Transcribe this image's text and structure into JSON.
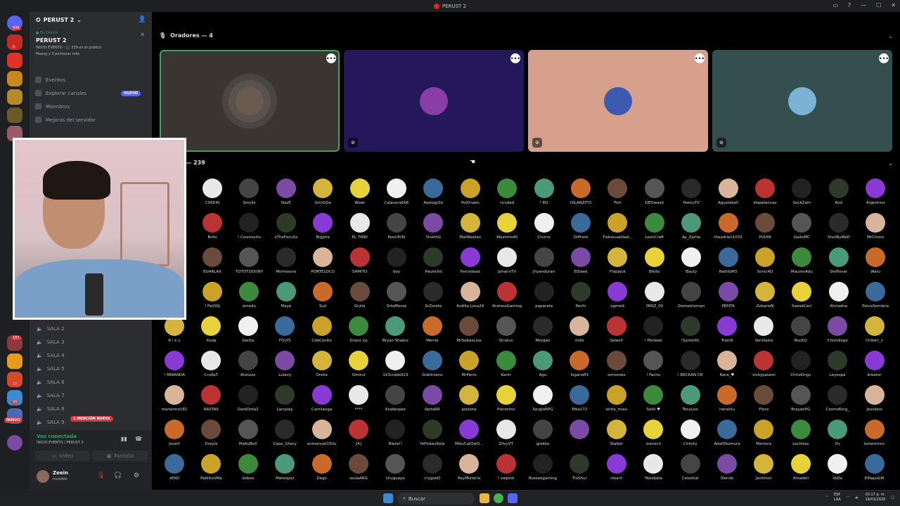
{
  "window": {
    "title": "PERUST 2",
    "controls": [
      "▭",
      "?",
      "—",
      "☐",
      "✕"
    ]
  },
  "server": {
    "name": "PERUST 2"
  },
  "event": {
    "live_label": "● En Directo",
    "name": "PERUST 2",
    "info": "INICIO EVENTO · 🎧 239 en el público",
    "attendees": "Maacg y 3 personas más"
  },
  "nav": [
    {
      "label": "Eventos",
      "badge": ""
    },
    {
      "label": "Explorar canales",
      "badge": "NUEVO"
    },
    {
      "label": "Miembros",
      "badge": ""
    },
    {
      "label": "Mejoras del servidor",
      "badge": ""
    }
  ],
  "channels": [
    "SALA 2",
    "SALA 3",
    "SALA 4",
    "SALA 5",
    "SALA 6",
    "SALA 7",
    "SALA 8",
    "SALA 9"
  ],
  "mention_badge": "1 MENCIÓN NUEVA",
  "guild_nuevo": "NUEVO",
  "guild_badges": [
    "698",
    "1",
    "187",
    "10",
    "33"
  ],
  "voice": {
    "status": "Voz conectada",
    "subtitle": "INICIO EVENTO / PERUST 2",
    "video_label": "Vídeo",
    "screen_label": "Pantalla"
  },
  "user": {
    "name": "Zeein",
    "status": "Invisible"
  },
  "speakers": {
    "header": "Oradores — 4",
    "tiles": [
      {
        "bg": "#3a3531",
        "avatar": "#6b5a50",
        "speaking": true
      },
      {
        "bg": "#24185a",
        "avatar": "#8a3ca8",
        "speaking": false
      },
      {
        "bg": "#d6a08c",
        "avatar": "#3c5bb0",
        "speaking": false
      },
      {
        "bg": "#33504f",
        "avatar": "#7ab3d4",
        "speaking": false
      }
    ]
  },
  "audience": {
    "header": "o — 239",
    "rows": [
      [
        "C0KEIN",
        "Smylls",
        "NazE",
        "GrinGGe",
        "Wowi",
        "Calavera666",
        "ApologiZe",
        "PoiOnako",
        "ricsded",
        "! M2",
        "DILANZITO",
        "Fish",
        "DEOwasd",
        "HerouTV",
        "Agustabell",
        "elapalancao",
        "SockZam",
        "Kod",
        "Argentino"
      ],
      [
        "Brito",
        "! Cosmecito",
        "xTheFocuSx",
        "BigJota",
        "EL TIRRI",
        "PoohToTo",
        "YinethG",
        "MattKeelan",
        "Mazinho40",
        "Churro",
        "Diffrent",
        "Tiokasualidad...",
        "LeonCraft",
        "Ay_Zarite",
        "theadrian1033",
        "PUDIN",
        "GaitoMC",
        "ShotByWolf",
        "MrChoco"
      ],
      [
        "EUARLAX",
        "TOTOTOOONY",
        "Momosora",
        "PORTELOCO",
        "SAMITO",
        "boy",
        "PaulieXd",
        "Fenixdead",
        "JohannTV",
        "Jhyanduran",
        "ElDaek",
        "Flapjack",
        "Bikito",
        "Bauty",
        "NathGM3",
        "Sonic4D",
        "MaurexAdu",
        "Steffovar",
        "Waru"
      ],
      [
        "! FeliSSJ",
        "omedu",
        "Maye",
        "Suit",
        "Giulio",
        "SrtaMoore",
        "SrZorete",
        "Ardilla Loca24",
        "KratossGaming",
        "paparata",
        "Pechi",
        "ogmeik",
        "!MDZ_00",
        "Demetrioman",
        "PEPITA",
        "ZekarioN",
        "SweetCeci",
        "Ahriadna",
        "ParcaSombria"
      ],
      [
        "R i k u",
        "Xoda",
        "Geitta",
        "FOLYS",
        "CdeConito",
        "Draco ssj",
        "Bryan Shakur",
        "Merrie",
        "MrSebasLive",
        "Stratus",
        "Morgan",
        "mills",
        "SeleeY",
        "! Porteee",
        "!Symerth",
        "Train9",
        "Vanillalce",
        "RocKG",
        "Chistologo",
        "Chiken_v"
      ],
      [
        "! MIRANDA",
        "CruKeT",
        "Alonzzo",
        "Lulavy",
        "Orsita",
        "OmiruI",
        "123crabell23",
        "Gobliniano",
        "MrPerro",
        "Karin",
        "Agu",
        "loganoff1",
        "srmomex",
        "! Facho",
        "! BECKAN CR",
        "Nara_♥",
        "vickypalami",
        "ChrisKings",
        "Leyespa",
        "kreator"
      ],
      [
        "marianno181",
        "RASTAS",
        "DarkDota2",
        "Larcplay",
        "Camilanga",
        "****",
        "Krakenpez",
        "AjotaRR",
        "jezzone",
        "Pierzinho",
        "SergioRPG",
        "Pika172",
        "airita_miau",
        "Soliii ♥",
        "TonyLoo",
        "irenelilu",
        "Flocs",
        "BrayanPG",
        "CosmoKing_",
        "Jessiboo"
      ],
      [
        "Josart",
        "Dreyla",
        "MaKuBeX",
        "Capo_Ghery",
        "enmanuel15tiv",
        "[A]",
        "Blaze!!",
        "YoPickeoSola",
        "MikuCatOwO...",
        "ZilvyVT",
        "grekko",
        "",
        "Stalker",
        "ivanech",
        "Cirilotv",
        "AdaiOkumura",
        "Martons",
        "Lechitax",
        "Ds",
        "kotaromnz"
      ],
      [
        "zEKO",
        "PablitoUMa",
        "kobea",
        "Mateopsz",
        "Dego",
        "lautaARG",
        "Uruguayo",
        "crygooD",
        "ReyMisterio",
        "! valpink",
        "Rosseegaming",
        "TioShur",
        "inkarri",
        "!Noobata",
        "Celestial",
        "Slendo",
        "Jeohmer",
        "Amadell",
        "Volta",
        "ElPapuGM"
      ]
    ]
  },
  "taskbar": {
    "search_placeholder": "Buscar",
    "lang": "ESP\nLAA",
    "time": "03:17 p. m.",
    "date": "19/03/2026"
  }
}
